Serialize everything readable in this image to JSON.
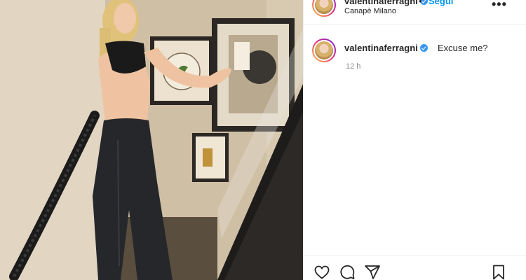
{
  "post": {
    "image_alt": "",
    "author": {
      "username": "valentinaferragni",
      "verified": true,
      "follow_label": "Segui",
      "separator": "•",
      "location": "Canapè Milano"
    },
    "caption": {
      "username": "valentinaferragni",
      "text": "Excuse me?",
      "time": "12 h"
    },
    "more_label": "•••",
    "actions": {
      "like": "heart-icon",
      "comment": "comment-icon",
      "share": "share-icon",
      "save": "bookmark-icon"
    }
  },
  "colors": {
    "text": "#262626",
    "link": "#0095f6",
    "muted": "#8e8e8e",
    "verified": "#3897f0",
    "border": "#efefef"
  }
}
